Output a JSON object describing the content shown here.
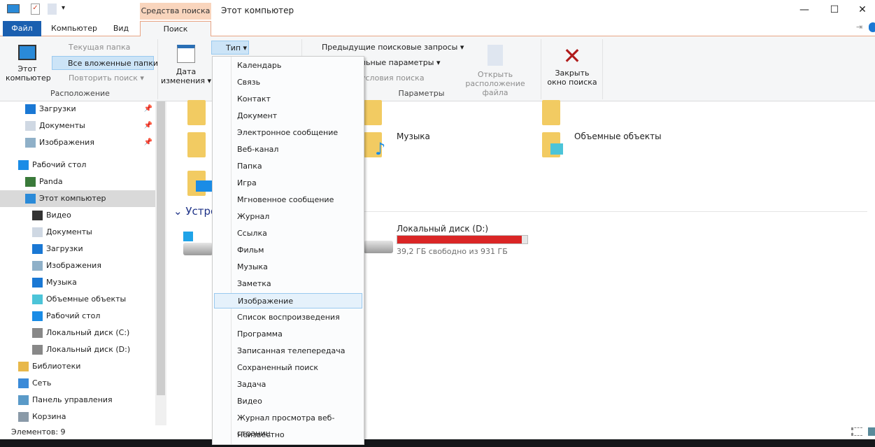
{
  "titlebar": {
    "context_tab": "Средства поиска",
    "title": "Этот компьютер",
    "minimize": "—",
    "maximize": "☐",
    "close": "✕"
  },
  "tabs": {
    "file": "Файл",
    "computer": "Компьютер",
    "view": "Вид",
    "search": "Поиск"
  },
  "ribbon": {
    "location": {
      "this_pc_line1": "Этот",
      "this_pc_line2": "компьютер",
      "current_folder": "Текущая папка",
      "all_subfolders": "Все вложенные папки",
      "repeat_search": "Повторить поиск",
      "label": "Расположение"
    },
    "refine": {
      "date_line1": "Дата",
      "date_line2": "изменения",
      "type": "Тип"
    },
    "options": {
      "recent_searches": "Предыдущие поисковые запросы",
      "advanced": "льные параметры",
      "conditions": "условия поиска",
      "label": "Параметры"
    },
    "open_location_line1": "Открыть",
    "open_location_line2": "расположение файла",
    "close_search_line1": "Закрыть",
    "close_search_line2": "окно поиска"
  },
  "sidebar": {
    "items": [
      {
        "label": "Загрузки",
        "pinned": true
      },
      {
        "label": "Документы",
        "pinned": true
      },
      {
        "label": "Изображения",
        "pinned": true
      },
      {
        "label": "Рабочий стол"
      },
      {
        "label": "Panda"
      },
      {
        "label": "Этот компьютер",
        "selected": true
      },
      {
        "label": "Видео"
      },
      {
        "label": "Документы"
      },
      {
        "label": "Загрузки"
      },
      {
        "label": "Изображения"
      },
      {
        "label": "Музыка"
      },
      {
        "label": "Объемные объекты"
      },
      {
        "label": "Рабочий стол"
      },
      {
        "label": "Локальный диск (C:)"
      },
      {
        "label": "Локальный диск (D:)"
      },
      {
        "label": "Библиотеки"
      },
      {
        "label": "Сеть"
      },
      {
        "label": "Панель управления"
      },
      {
        "label": "Корзина"
      }
    ]
  },
  "content": {
    "music": "Музыка",
    "objects3d": "Объемные объекты",
    "devices_header": "Устро",
    "drive_d": {
      "name": "Локальный диск (D:)",
      "free": "39,2 ГБ свободно из 931 ГБ",
      "used_fraction": 0.958
    }
  },
  "type_menu": {
    "items": [
      "Календарь",
      "Связь",
      "Контакт",
      "Документ",
      "Электронное сообщение",
      "Веб-канал",
      "Папка",
      "Игра",
      "Мгновенное сообщение",
      "Журнал",
      "Ссылка",
      "Фильм",
      "Музыка",
      "Заметка",
      "Изображение",
      "Список воспроизведения",
      "Программа",
      "Записанная телепередача",
      "Сохраненный поиск",
      "Задача",
      "Видео",
      "Журнал просмотра веб-страниц",
      "Неизвестно"
    ],
    "highlighted": "Изображение"
  },
  "status": {
    "items_count": "Элементов: 9"
  },
  "colors": {
    "accent": "#1a5fb0",
    "context": "#f9d5bd",
    "disk_bar": "#da2626"
  }
}
